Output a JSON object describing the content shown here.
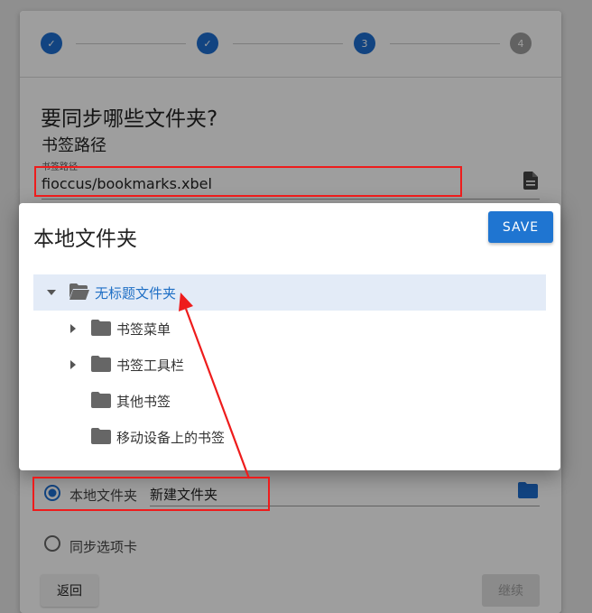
{
  "stepper": {
    "steps": [
      "✓",
      "✓",
      "3",
      "4"
    ]
  },
  "page": {
    "heading": "要同步哪些文件夹?",
    "subheading": "书签路径",
    "path_label": "书签路径",
    "path_value": "fioccus/bookmarks.xbel"
  },
  "options": {
    "local_label": "本地文件夹",
    "local_value": "新建文件夹",
    "tabs_label": "同步选项卡",
    "back": "返回",
    "continue": "继续"
  },
  "dialog": {
    "title": "本地文件夹",
    "save": "SAVE",
    "tree": [
      {
        "label": "无标题文件夹",
        "state": "expanded",
        "selected": true
      },
      {
        "label": "书签菜单",
        "state": "collapsed"
      },
      {
        "label": "书签工具栏",
        "state": "collapsed"
      },
      {
        "label": "其他书签",
        "state": "leaf"
      },
      {
        "label": "移动设备上的书签",
        "state": "leaf"
      }
    ]
  },
  "colors": {
    "accent": "#1f75d1",
    "annotation": "#ee1c1c"
  }
}
